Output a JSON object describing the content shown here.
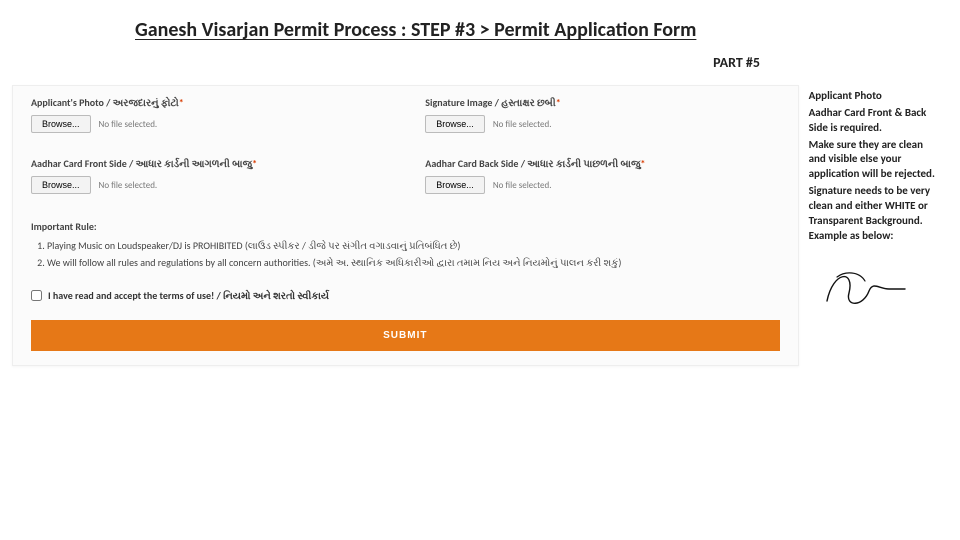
{
  "header": {
    "title": "Ganesh Visarjan Permit Process : STEP #3 > Permit Application Form",
    "part": "PART #5"
  },
  "form": {
    "fields": {
      "photo": {
        "label": "Applicant's Photo / અરજદારનું ફોટો",
        "browse": "Browse...",
        "nofile": "No file selected."
      },
      "signature": {
        "label": "Signature Image / હસ્તાક્ષર છબી",
        "browse": "Browse...",
        "nofile": "No file selected."
      },
      "aadhar_front": {
        "label": "Aadhar Card Front Side / આધાર કાર્ડની આગળની બાજુ",
        "browse": "Browse...",
        "nofile": "No file selected."
      },
      "aadhar_back": {
        "label": "Aadhar Card Back Side / આધાર કાર્ડની પાછળની બાજુ",
        "browse": "Browse...",
        "nofile": "No file selected."
      }
    },
    "rules_title": "Important Rule:",
    "rules": [
      "Playing Music on Loudspeaker/DJ is PROHIBITED (લાઉડ સ્પીકર / ડીજે પર સંગીત વગાડવાનું પ્રતિબંધિત છે)",
      "We will follow all rules and regulations by all concern authorities. (અમે અ. સ્થાનિક અધિકારીઓ દ્વારા તમામ નિય અને નિયમોનું પાલન કરી શકું)"
    ],
    "terms": "I have read and accept the terms of use! / નિયમો અને શરતો સ્વીકાર્ય",
    "submit": "SUBMIT"
  },
  "notes": {
    "l1": "Applicant Photo",
    "l2": "Aadhar Card Front & Back Side is required.",
    "l3": "Make sure they are clean and visible else your application will be rejected.",
    "l4": "Signature needs to be very clean and either WHITE or Transparent Background. Example as below:"
  }
}
